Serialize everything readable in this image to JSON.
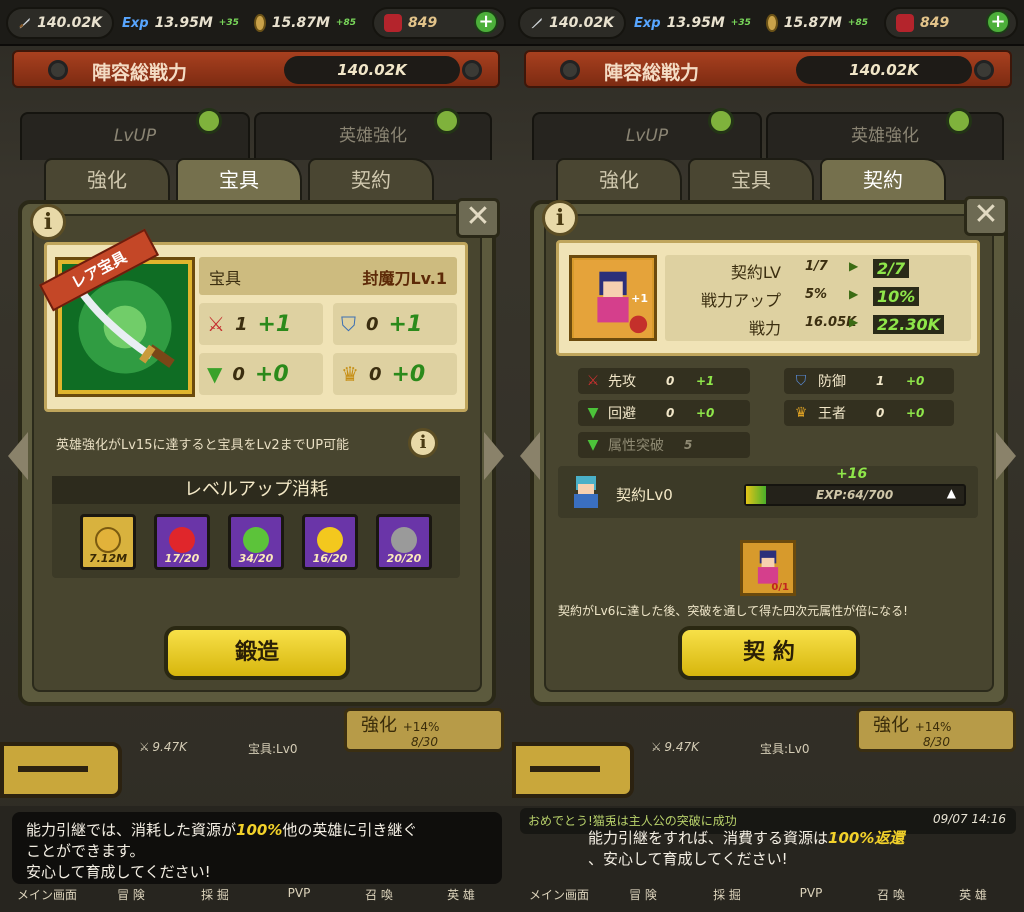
{
  "left": {
    "resources": {
      "power": "140.02K",
      "exp": "13.95M",
      "exp_rate": "+35",
      "gold": "15.87M",
      "gold_rate": "+85",
      "gems": "849"
    },
    "banner": {
      "title": "陣容総戦力",
      "power": "140.02K"
    },
    "top_tabs": [
      "LvUP",
      "英雄強化"
    ],
    "tabs": [
      "強化",
      "宝具",
      "契約"
    ],
    "active_tab": "宝具",
    "treasure": {
      "ribbon": "レア宝具",
      "label": "宝具",
      "name": "封魔刀Lv.1",
      "stats": [
        {
          "icon": "sword-icon",
          "base": "1",
          "bonus": "+1"
        },
        {
          "icon": "shield-icon",
          "base": "0",
          "bonus": "+1"
        },
        {
          "icon": "wind-icon",
          "base": "0",
          "bonus": "+0"
        },
        {
          "icon": "crown-icon",
          "base": "0",
          "bonus": "+0"
        }
      ]
    },
    "hint": "英雄強化がLv15に達すると宝具をLv2までUP可能",
    "cost_title": "レベルアップ消耗",
    "costs": [
      {
        "icon": "gold-coin-icon",
        "count": "7.12M",
        "color": "#e2b23a"
      },
      {
        "icon": "red-orb-icon",
        "count": "17/20",
        "color": "#e0262b"
      },
      {
        "icon": "green-orb-icon",
        "count": "34/20",
        "color": "#5cc33a"
      },
      {
        "icon": "yellow-orb-icon",
        "count": "16/20",
        "color": "#f3c81e"
      },
      {
        "icon": "gray-orb-icon",
        "count": "20/20",
        "color": "#9a9a9a"
      }
    ],
    "forge_button": "鍛造",
    "below": {
      "power": "9.47K",
      "treasure": "宝具:Lv0",
      "upgrade": "強化",
      "progress": "8/30",
      "rate": "+14%"
    },
    "message_line1_pre": "能力引継では、消耗した資源が",
    "message_pct": "100%",
    "message_line1_post": "他の英雄に引き継ぐ",
    "message_line2": "ことができます。",
    "message_line3": "安心して育成してください!",
    "nav": [
      "メイン画面",
      "冒 険",
      "採 掘",
      "PVP",
      "召 喚",
      "英 雄"
    ]
  },
  "right": {
    "resources": {
      "power": "140.02K",
      "exp": "13.95M",
      "exp_rate": "+35",
      "gold": "15.87M",
      "gold_rate": "+85",
      "gems": "849"
    },
    "banner": {
      "title": "陣容総戦力",
      "power": "140.02K"
    },
    "top_tabs": [
      "LvUP",
      "英雄強化"
    ],
    "tabs": [
      "強化",
      "宝具",
      "契約"
    ],
    "active_tab": "契約",
    "contract": {
      "badge": "+1",
      "rows": [
        {
          "label": "契約LV",
          "from": "1/7",
          "to": "2/7"
        },
        {
          "label": "戦力アップ",
          "from": "5%",
          "to": "10%"
        },
        {
          "label": "戦力",
          "from": "16.05K",
          "to": "22.30K"
        }
      ],
      "attrs": [
        {
          "icon": "sword-icon",
          "label": "先攻",
          "base": "0",
          "bonus": "+1"
        },
        {
          "icon": "shield-icon",
          "label": "防御",
          "base": "1",
          "bonus": "+0"
        },
        {
          "icon": "wind-icon",
          "label": "回避",
          "base": "0",
          "bonus": "+0"
        },
        {
          "icon": "crown-icon",
          "label": "王者",
          "base": "0",
          "bonus": "+0"
        },
        {
          "icon": "wind-icon",
          "label": "属性突破",
          "base": "5",
          "bonus": ""
        }
      ],
      "level_label": "契約Lv0",
      "gain": "+16",
      "exp": "EXP:64/700",
      "exp_fraction": 0.09,
      "item_count": "0/1",
      "note": "契約がLv6に達した後、突破を通して得た四次元属性が倍になる!",
      "button": "契 約"
    },
    "below": {
      "power": "9.47K",
      "treasure": "宝具:Lv0",
      "upgrade": "強化",
      "progress": "8/30",
      "rate": "+14%"
    },
    "ticker": "おめでとう!猫兎は主人公の突破に成功",
    "ticker_time": "09/07 14:16",
    "message_line1_pre": "能力引継をすれば、消費する資源は",
    "message_pct": "100%返還",
    "message_line2": "、安心して育成してください!",
    "nav": [
      "メイン画面",
      "冒 険",
      "採 掘",
      "PVP",
      "召 喚",
      "英 雄"
    ]
  }
}
